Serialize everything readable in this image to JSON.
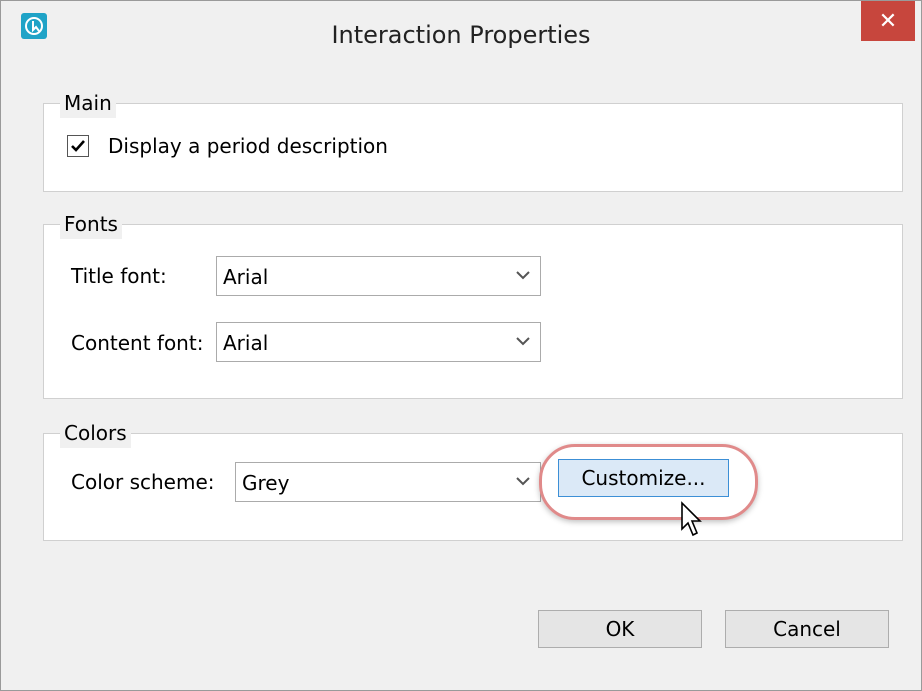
{
  "window": {
    "title": "Interaction Properties",
    "close_label": "✕"
  },
  "main": {
    "legend": "Main",
    "checkbox_label": "Display a period description",
    "checked": true
  },
  "fonts": {
    "legend": "Fonts",
    "title_font_label": "Title font:",
    "title_font_value": "Arial",
    "content_font_label": "Content font:",
    "content_font_value": "Arial"
  },
  "colors": {
    "legend": "Colors",
    "scheme_label": "Color scheme:",
    "scheme_value": "Grey",
    "customize_label": "Customize..."
  },
  "buttons": {
    "ok": "OK",
    "cancel": "Cancel"
  },
  "icons": {
    "app": "interaction-app-icon",
    "close": "close-icon",
    "check": "checkmark-icon",
    "dropdown": "chevron-down-icon",
    "cursor": "mouse-pointer-icon"
  },
  "style_colors": {
    "close_button": "#c7463d",
    "focus_border": "#3c8fd6",
    "highlight_ring": "#e08a8a"
  }
}
